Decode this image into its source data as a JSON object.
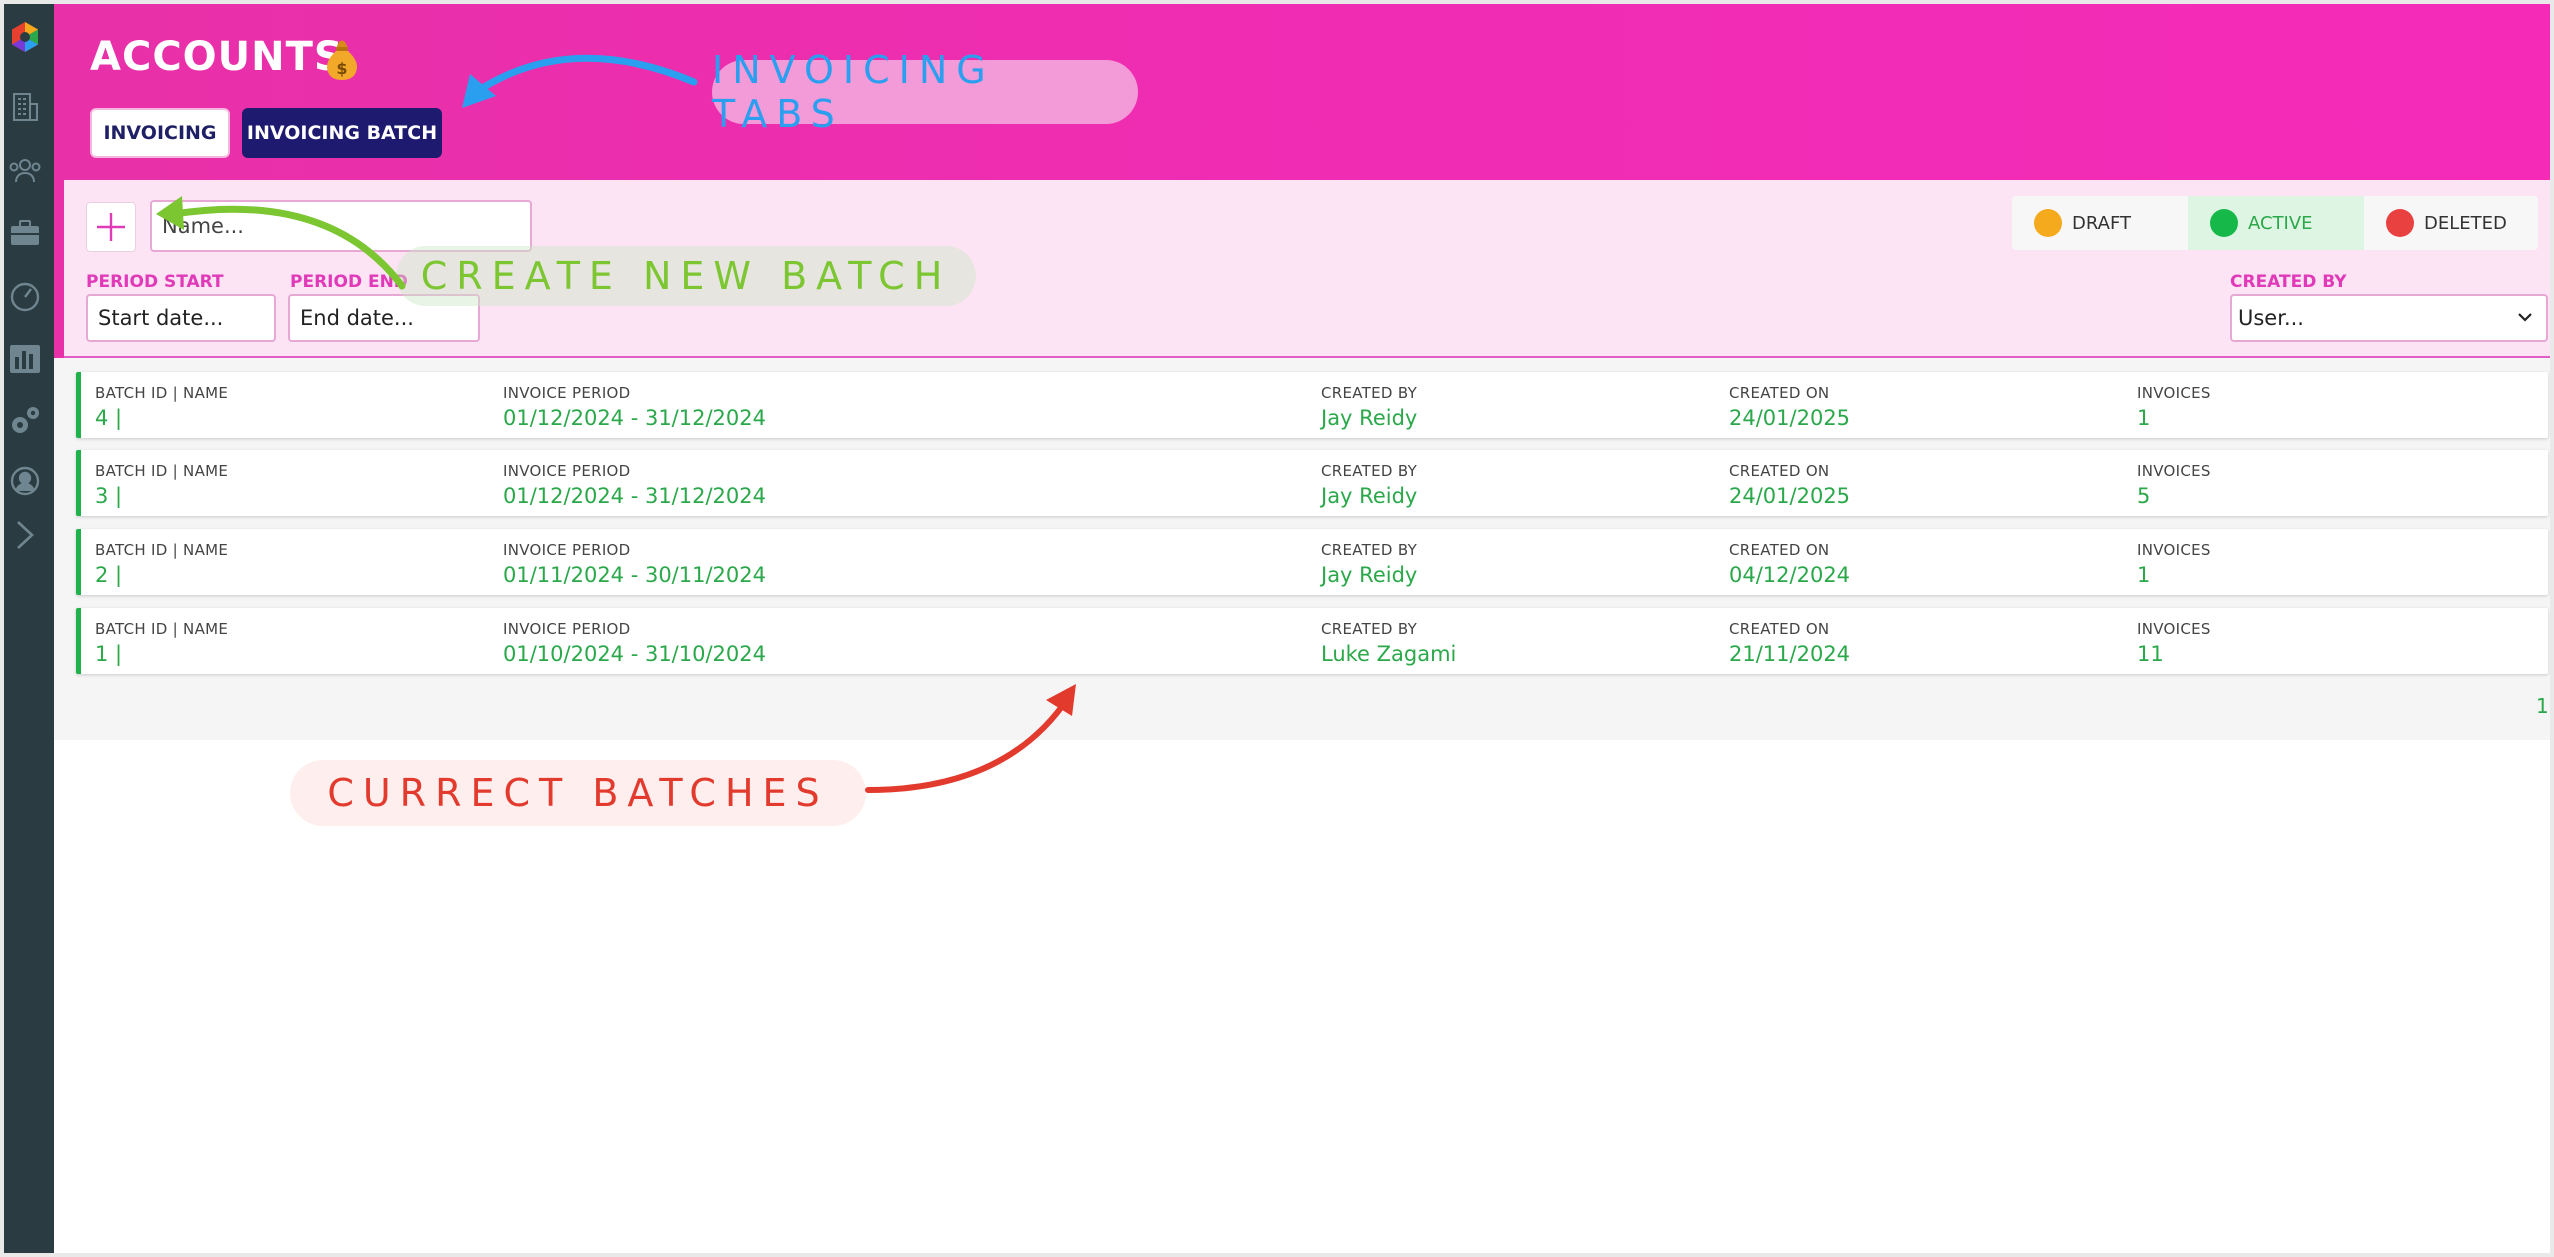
{
  "page": {
    "title": "ACCOUNTS",
    "title_icon": "money-bag-icon"
  },
  "tabs": [
    {
      "label": "INVOICING",
      "active": false
    },
    {
      "label": "INVOICING BATCH",
      "active": true
    }
  ],
  "annotations": {
    "tabs": "INVOICING TABS",
    "create": "CREATE NEW BATCH",
    "batches": "CURRECT BATCHES"
  },
  "filters": {
    "name_placeholder": "Name...",
    "period_start_label": "PERIOD START",
    "period_start_placeholder": "Start date...",
    "period_end_label": "PERIOD END",
    "period_end_placeholder": "End date...",
    "created_by_label": "CREATED BY",
    "created_by_value": "User..."
  },
  "legend": [
    {
      "label": "DRAFT",
      "color": "#f5a91d"
    },
    {
      "label": "ACTIVE",
      "color": "#16b84a"
    },
    {
      "label": "DELETED",
      "color": "#e94040"
    }
  ],
  "columns": {
    "batch": "BATCH ID | NAME",
    "period": "INVOICE PERIOD",
    "created_by": "CREATED BY",
    "created_on": "CREATED ON",
    "invoices": "INVOICES"
  },
  "rows": [
    {
      "batch": "4 |",
      "period": "01/12/2024 - 31/12/2024",
      "created_by": "Jay Reidy",
      "created_on": "24/01/2025",
      "invoices": "1"
    },
    {
      "batch": "3 |",
      "period": "01/12/2024 - 31/12/2024",
      "created_by": "Jay Reidy",
      "created_on": "24/01/2025",
      "invoices": "5"
    },
    {
      "batch": "2 |",
      "period": "01/11/2024 - 30/11/2024",
      "created_by": "Jay Reidy",
      "created_on": "04/12/2024",
      "invoices": "1"
    },
    {
      "batch": "1 |",
      "period": "01/10/2024 - 31/10/2024",
      "created_by": "Luke Zagami",
      "created_on": "21/11/2024",
      "invoices": "11"
    }
  ],
  "pagination": {
    "current": "1"
  },
  "colors": {
    "accent": "#f02cb4",
    "tab_active": "#1e1a70",
    "status_green": "#2aa84a",
    "sidebar": "#2a3b42"
  }
}
